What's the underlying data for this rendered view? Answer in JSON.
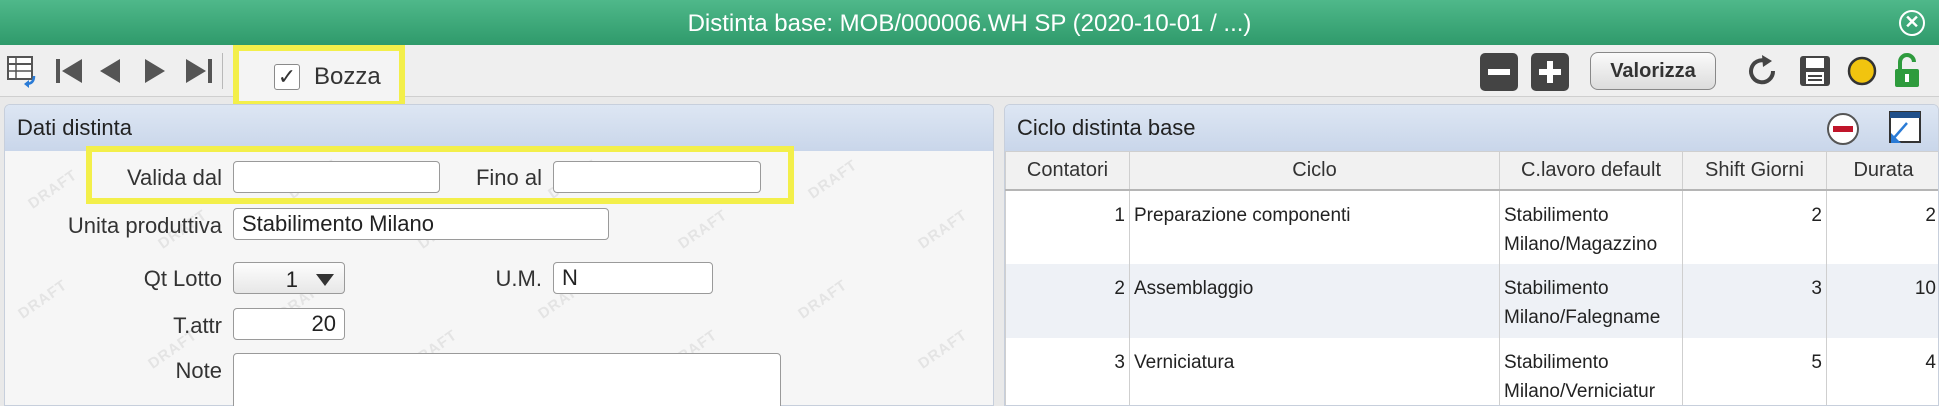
{
  "window": {
    "title": "Distinta base: MOB/000006.WH SP (2020-10-01 / ...)"
  },
  "toolbar": {
    "bozza_label": "Bozza",
    "bozza_checked": true,
    "valorizza_label": "Valorizza"
  },
  "left": {
    "title": "Dati distinta",
    "watermark": "DRAFT",
    "valida_dal_label": "Valida dal",
    "valida_dal_value": "",
    "fino_al_label": "Fino al",
    "fino_al_value": "",
    "unita_label": "Unita produttiva",
    "unita_value": "Stabilimento Milano",
    "qt_lotto_label": "Qt Lotto",
    "qt_lotto_value": "1",
    "um_label": "U.M.",
    "um_value": "N",
    "tattr_label": "T.attr",
    "tattr_value": "20",
    "note_label": "Note",
    "note_value": ""
  },
  "right": {
    "title": "Ciclo distinta base",
    "columns": [
      "Contatori",
      "Ciclo",
      "C.lavoro default",
      "Shift Giorni",
      "Durata"
    ],
    "rows": [
      {
        "contatori": "1",
        "ciclo": "Preparazione componenti",
        "lavoro_1": "Stabilimento",
        "lavoro_2": "Milano/Magazzino",
        "shift": "2",
        "durata": "2"
      },
      {
        "contatori": "2",
        "ciclo": "Assemblaggio",
        "lavoro_1": "Stabilimento",
        "lavoro_2": "Milano/Falegname",
        "shift": "3",
        "durata": "10"
      },
      {
        "contatori": "3",
        "ciclo": "Verniciatura",
        "lavoro_1": "Stabilimento",
        "lavoro_2": "Milano/Verniciatur",
        "shift": "5",
        "durata": "4"
      }
    ]
  },
  "colors": {
    "titlebar": "#3aa87a",
    "highlight": "#f3ef4a",
    "panel_header": "#d3deee"
  }
}
